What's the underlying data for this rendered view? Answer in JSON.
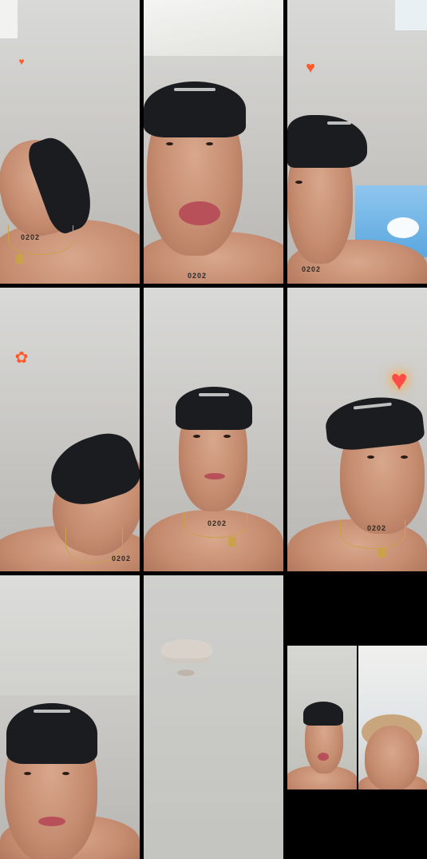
{
  "layout": {
    "columns": 3,
    "rows": 3
  },
  "tiles": [
    {
      "id": "tile-1",
      "tattoo": "0202",
      "overlay": "heart-spark-icon"
    },
    {
      "id": "tile-2",
      "tattoo": "0202"
    },
    {
      "id": "tile-3",
      "tattoo": "0202",
      "overlay": "heart-gift-icon"
    },
    {
      "id": "tile-4",
      "tattoo": "0202",
      "overlay": "gift-character-icon"
    },
    {
      "id": "tile-5",
      "tattoo": "0202"
    },
    {
      "id": "tile-6",
      "tattoo": "0202",
      "overlay": "glowing-heart-icon"
    },
    {
      "id": "tile-7"
    },
    {
      "id": "tile-8",
      "overlay": "cowboy-hat-mustache-icon"
    },
    {
      "id": "tile-9",
      "pip_participants": 2
    }
  ],
  "overlays": {
    "heart": "♥",
    "gift": "✿"
  },
  "colors": {
    "background": "#000000",
    "cap": "#1b1c1f",
    "chain": "#c9a24a",
    "heart": "#ff4a4a"
  }
}
